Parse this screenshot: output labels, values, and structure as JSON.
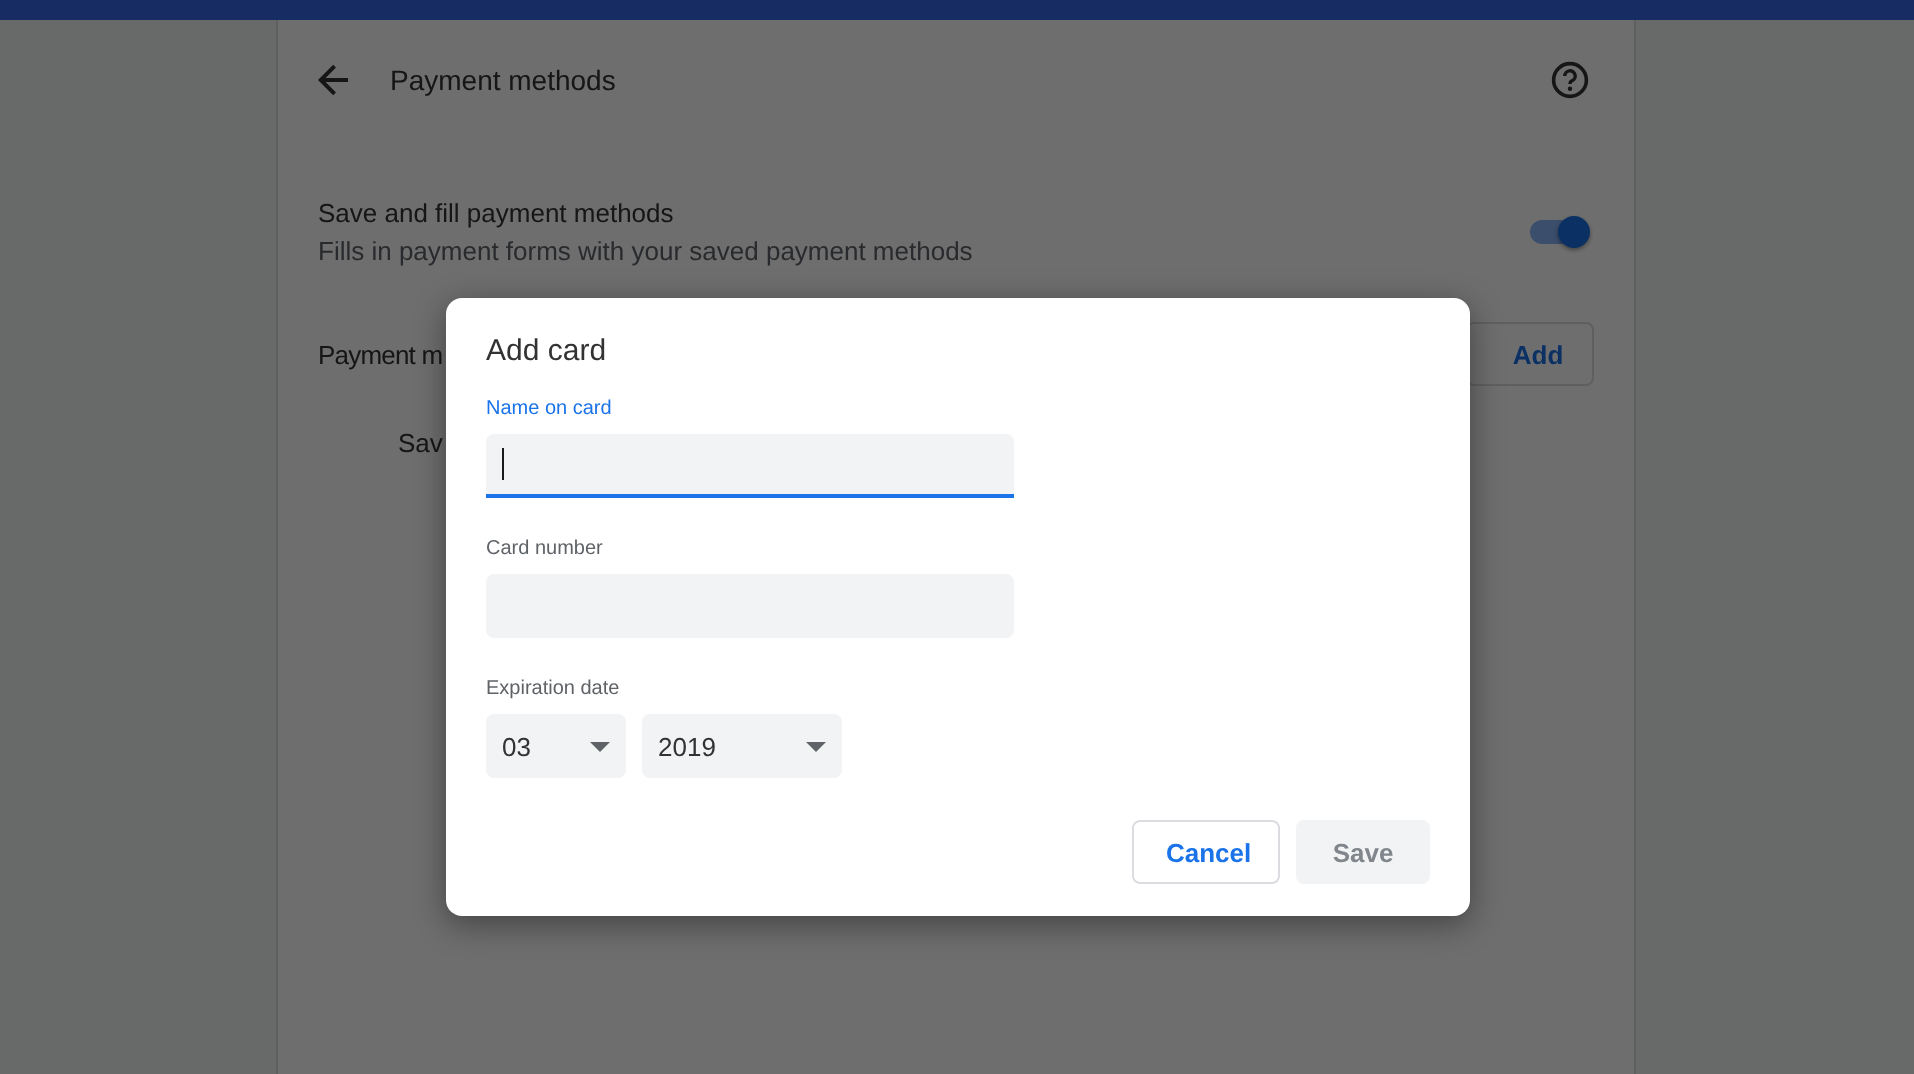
{
  "page": {
    "title": "Payment methods",
    "setting": {
      "label": "Save and fill payment methods",
      "description": "Fills in payment forms with your saved payment methods",
      "on": true
    },
    "section_label": "Payment m",
    "add_button": "Add",
    "row_text": "Sav"
  },
  "dialog": {
    "title": "Add card",
    "fields": [
      {
        "label": "Name on card",
        "focused": true
      },
      {
        "label": "Card number",
        "focused": false
      }
    ],
    "expiration": {
      "label": "Expiration date",
      "month": "03",
      "year": "2019"
    },
    "buttons": [
      {
        "label": "Cancel",
        "disabled": false
      },
      {
        "label": "Save",
        "disabled": true
      }
    ]
  }
}
